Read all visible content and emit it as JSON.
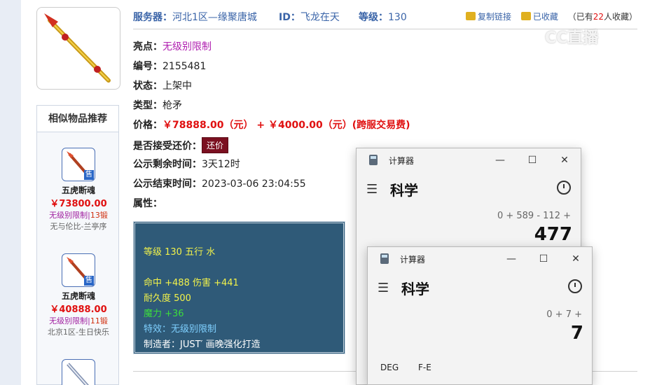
{
  "header": {
    "server_label": "服务器：",
    "server_value": "河北1区—缘聚唐城",
    "id_label": "ID：",
    "id_value": "飞龙在天",
    "level_label": "等级：",
    "level_value": "130",
    "copy_link": "复制链接",
    "favorited": "已收藏",
    "fav_prefix": "（已有",
    "fav_count": "22",
    "fav_suffix": "人收藏）"
  },
  "watermark": "CC直播",
  "detail": {
    "highlight_label": "亮点：",
    "highlight_value": "无级别限制",
    "number_label": "编号：",
    "number_value": "2155481",
    "status_label": "状态：",
    "status_value": "上架中",
    "type_label": "类型：",
    "type_value": "枪矛",
    "price_label": "价格：",
    "price_value": "￥78888.00（元） + ￥4000.00（元）(跨服交易费)",
    "bargain_label": "是否接受还价：",
    "bargain_button": "还价",
    "remain_label": "公示剩余时间：",
    "remain_value": "3天12时",
    "end_label": "公示结束时间：",
    "end_value": "2023-03-06 23:04:55",
    "attr_label": "属性："
  },
  "attributes": {
    "line1": "等级 130 五行 水",
    "line2": "命中 +488 伤害 +441",
    "line3": "耐久度 500",
    "line4": "魔力 +36",
    "line5": "特效：无级别限制",
    "line6": "制造者：JUST′ 画晚强化打造"
  },
  "similar": {
    "title": "相似物品推荐",
    "sell_badge": "售",
    "items": [
      {
        "name": "五虎断魂",
        "price": "￥73800.00",
        "tag": "无级别限制",
        "level": "13锻",
        "server": "无与伦比-兰亭序"
      },
      {
        "name": "五虎断魂",
        "price": "￥40888.00",
        "tag": "无级别限制",
        "level": "11锻",
        "server": "北京1区-生日快乐"
      }
    ]
  },
  "calc1": {
    "title": "计算器",
    "mode": "科学",
    "expr": "0 + 589 - 112 +",
    "result": "477"
  },
  "calc2": {
    "title": "计算器",
    "mode": "科学",
    "expr": "0 + 7 +",
    "result": "7",
    "deg": "DEG",
    "fe": "F-E"
  }
}
